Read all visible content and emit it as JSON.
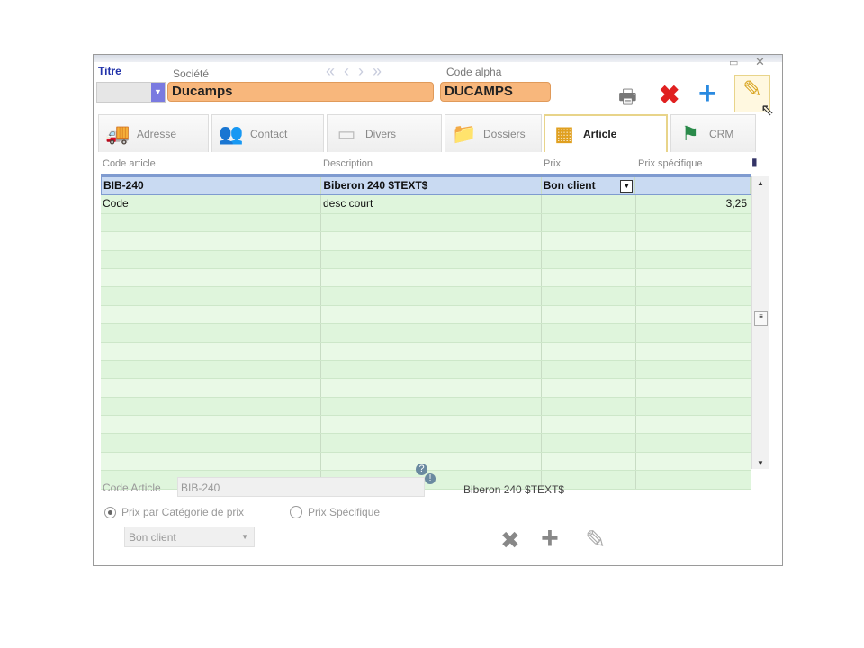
{
  "header": {
    "titre_label": "Titre",
    "societe_label": "Société",
    "societe_value": "Ducamps",
    "code_alpha_label": "Code alpha",
    "code_alpha_value": "DUCAMPS",
    "nav": [
      "«",
      "‹",
      "›",
      "»"
    ]
  },
  "tabs": [
    {
      "label": "Adresse",
      "icon": "truck-icon"
    },
    {
      "label": "Contact",
      "icon": "people-icon"
    },
    {
      "label": "Divers",
      "icon": "folder-icon"
    },
    {
      "label": "Dossiers",
      "icon": "folder-blue-icon"
    },
    {
      "label": "Article",
      "icon": "blocks-icon",
      "active": true
    },
    {
      "label": "CRM",
      "icon": "signpost-icon"
    }
  ],
  "grid": {
    "columns": [
      "Code article",
      "Description",
      "Prix",
      "Prix spécifique"
    ],
    "rows": [
      {
        "code": "BIB-240",
        "desc": "Biberon 240  $TEXT$",
        "prix": "Bon client",
        "spec": ""
      },
      {
        "code": "Code",
        "desc": "desc court",
        "prix": "",
        "spec": "3,25"
      }
    ]
  },
  "detail": {
    "code_article_label": "Code Article",
    "code_article_value": "BIB-240",
    "description": "Biberon 240  $TEXT$",
    "radio1": "Prix par Catégorie de prix",
    "radio2": "Prix Spécifique",
    "select_value": "Bon client"
  }
}
